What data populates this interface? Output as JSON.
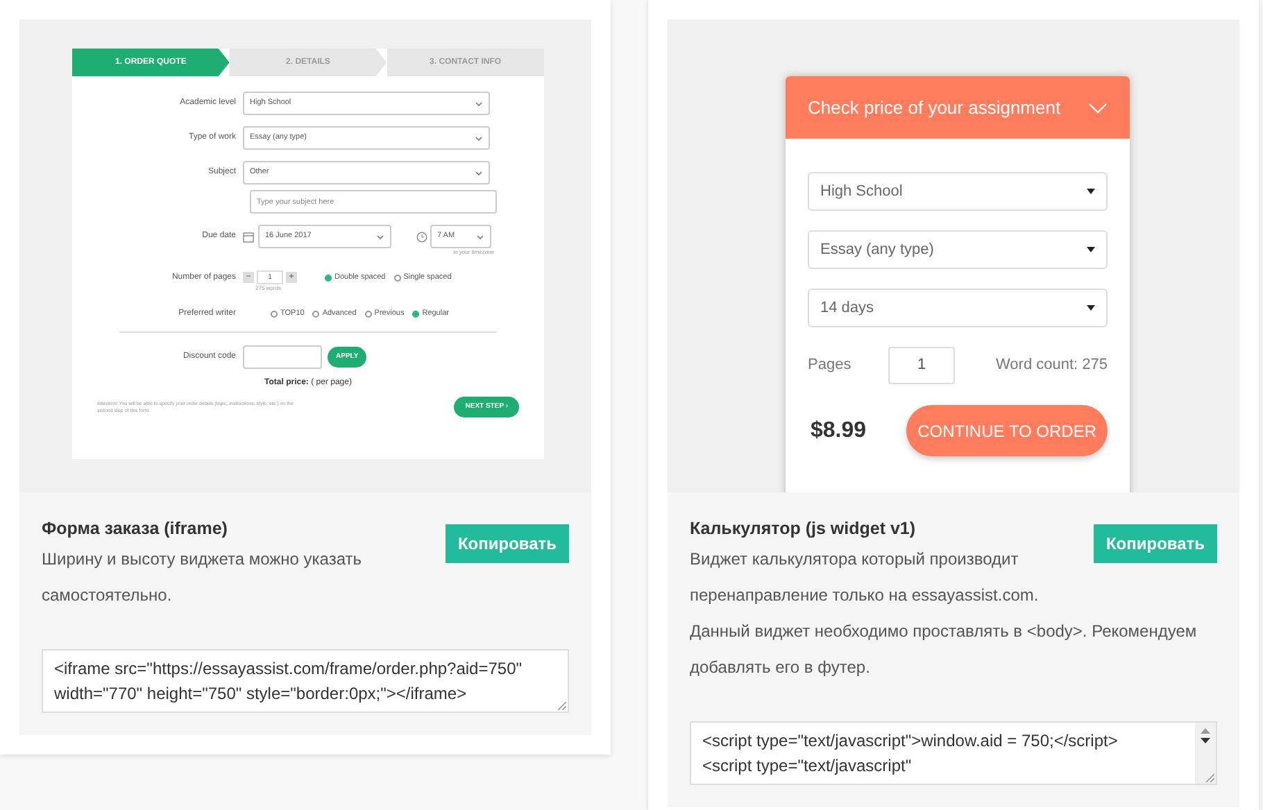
{
  "cards": [
    {
      "kind": "order_form",
      "preview": {
        "steps": [
          {
            "label": "1. ORDER QUOTE",
            "selected": true
          },
          {
            "label": "2. DETAILS",
            "selected": false
          },
          {
            "label": "3. CONTACT INFO",
            "selected": false
          }
        ],
        "academic_level": {
          "label": "Academic level",
          "value": "High School"
        },
        "type_of_work": {
          "label": "Type of work",
          "value": "Essay (any type)"
        },
        "subject": {
          "label": "Subject",
          "value": "Other",
          "placeholder": "Type your subject here"
        },
        "due_date": {
          "label": "Due date",
          "date": "16 June 2017",
          "time": "7 AM",
          "hint": "in your timezone"
        },
        "pages": {
          "label": "Number of pages",
          "minus": "−",
          "value": "1",
          "plus": "+",
          "words": "275 words",
          "spacing": [
            {
              "label": "Double spaced",
              "selected": true
            },
            {
              "label": "Single spaced",
              "selected": false
            }
          ]
        },
        "writer": {
          "label": "Preferred writer",
          "options": [
            {
              "label": "TOP10",
              "selected": false
            },
            {
              "label": "Advanced",
              "selected": false
            },
            {
              "label": "Previous",
              "selected": false
            },
            {
              "label": "Regular",
              "selected": true
            }
          ]
        },
        "discount": {
          "label": "Discount code",
          "button": "APPLY"
        },
        "total": "**Total price:** ( per page)",
        "note": "Attention! You will be able to specify your order details (topic, instructions, style, etc.) on the second step of this form.",
        "next_button": "NEXT STEP ›"
      },
      "title": "Форма заказа (iframe)",
      "description": [
        "Ширину и высоту виджета можно указать самостоятельно."
      ],
      "copy_button": "Копировать",
      "code": [
        "<iframe src=\"https://essayassist.com/frame/order.php?aid=750\"",
        "width=\"770\" height=\"750\" style=\"border:0px;\"></iframe>"
      ]
    },
    {
      "kind": "calculator",
      "preview": {
        "header": "Check price of your assignment",
        "selects": [
          "High School",
          "Essay (any type)",
          "14 days"
        ],
        "pages_label": "Pages",
        "pages_value": "1",
        "word_count": "Word count: 275",
        "price": "$8.99",
        "button": "CONTINUE TO ORDER"
      },
      "title": "Калькулятор (js widget v1)",
      "description": [
        "Виджет калькулятора который производит перенаправление только на essayassist.com.",
        "Данный виджет необходимо проставлять в <body>. Рекомендуем добавлять его в футер."
      ],
      "copy_button": "Копировать",
      "code": [
        "<script type=\"text/javascript\">window.aid = 750;</script>",
        "<script type=\"text/javascript\""
      ]
    }
  ]
}
